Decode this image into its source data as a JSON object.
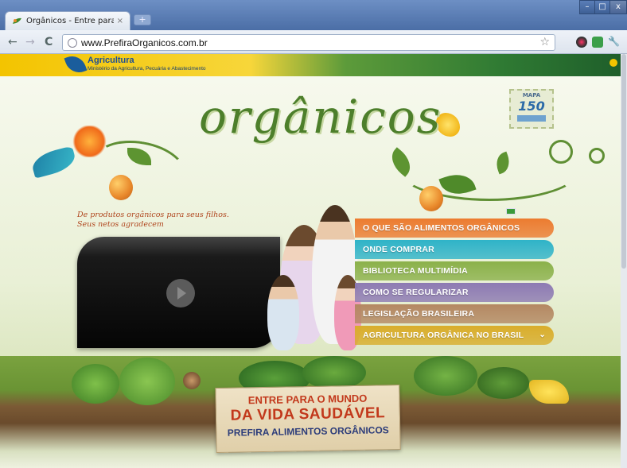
{
  "browser": {
    "tab_title": "Orgânicos - Entre para o ...",
    "tab_close": "×",
    "new_tab": "+",
    "url": "www.PrefiraOrganicos.com.br",
    "back": "←",
    "forward": "→",
    "reload": "C",
    "star": "☆",
    "minimize": "–",
    "maximize": "□",
    "close": "x",
    "wrench": "🔧"
  },
  "gov": {
    "title": "Agricultura",
    "subtitle": "Ministério da Agricultura, Pecuária e Abastecimento"
  },
  "logo": "orgânicos",
  "seal": {
    "top": "MAPA",
    "number": "150"
  },
  "slogan": {
    "line1": "De produtos orgânicos para seus filhos.",
    "line2": "Seus netos agradecem"
  },
  "menu": [
    {
      "label": "O QUE SÃO ALIMENTOS ORGÂNICOS",
      "color": "#ec7b2f"
    },
    {
      "label": "ONDE COMPRAR",
      "color": "#2fb3c8"
    },
    {
      "label": "BIBLIOTECA MULTIMÍDIA",
      "color": "#8bb14a"
    },
    {
      "label": "COMO SE REGULARIZAR",
      "color": "#8d7ab3"
    },
    {
      "label": "LEGISLAÇÃO BRASILEIRA",
      "color": "#b48862"
    },
    {
      "label": "AGRICULTURA ORGÂNICA NO BRASIL",
      "color": "#d9ad2b",
      "chevron": "⌄"
    }
  ],
  "banner": {
    "line1": "ENTRE PARA O MUNDO",
    "line2": "DA VIDA SAUDÁVEL",
    "line3": "PREFIRA ALIMENTOS ORGÂNICOS"
  }
}
